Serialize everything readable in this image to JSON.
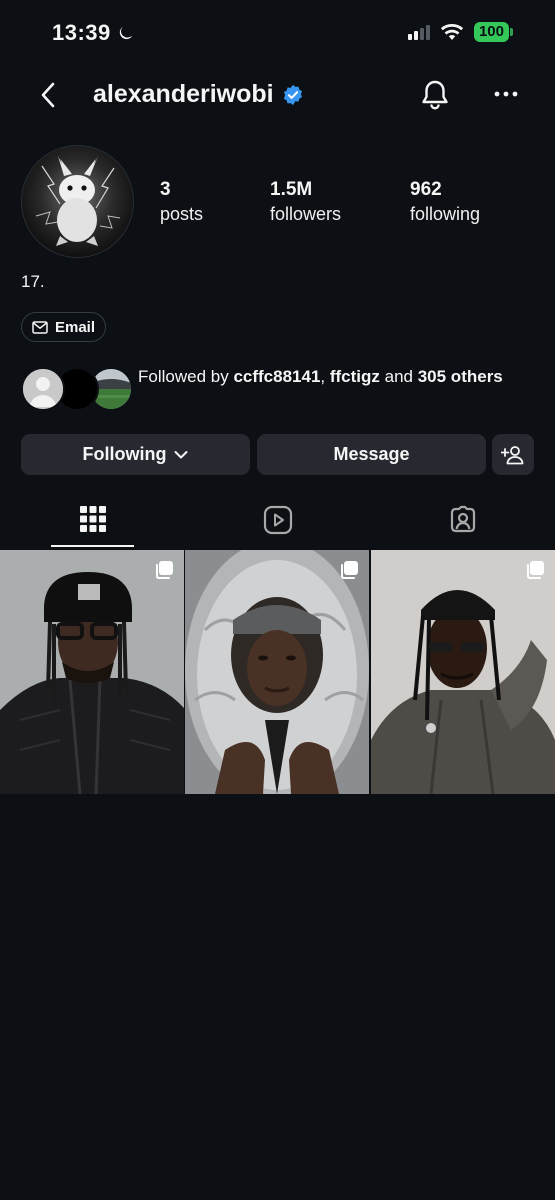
{
  "status_bar": {
    "time": "13:39",
    "battery": "100"
  },
  "header": {
    "username": "alexanderiwobi"
  },
  "profile": {
    "stats": [
      {
        "value": "3",
        "label": "posts"
      },
      {
        "value": "1.5M",
        "label": "followers"
      },
      {
        "value": "962",
        "label": "following"
      }
    ],
    "bio": "17.",
    "email_label": "Email"
  },
  "followed_by": {
    "prefix": "Followed by ",
    "user1": "ccffc88141",
    "sep": ", ",
    "user2": "ffctigz",
    "and": " and ",
    "others": "305 others"
  },
  "actions": {
    "following_label": "Following",
    "message_label": "Message"
  },
  "tabs": [
    "grid-icon",
    "reels-icon",
    "tagged-icon"
  ],
  "colors": {
    "background": "#0c1014",
    "button": "#262a30",
    "verified": "#3797f0",
    "battery": "#34c759"
  }
}
